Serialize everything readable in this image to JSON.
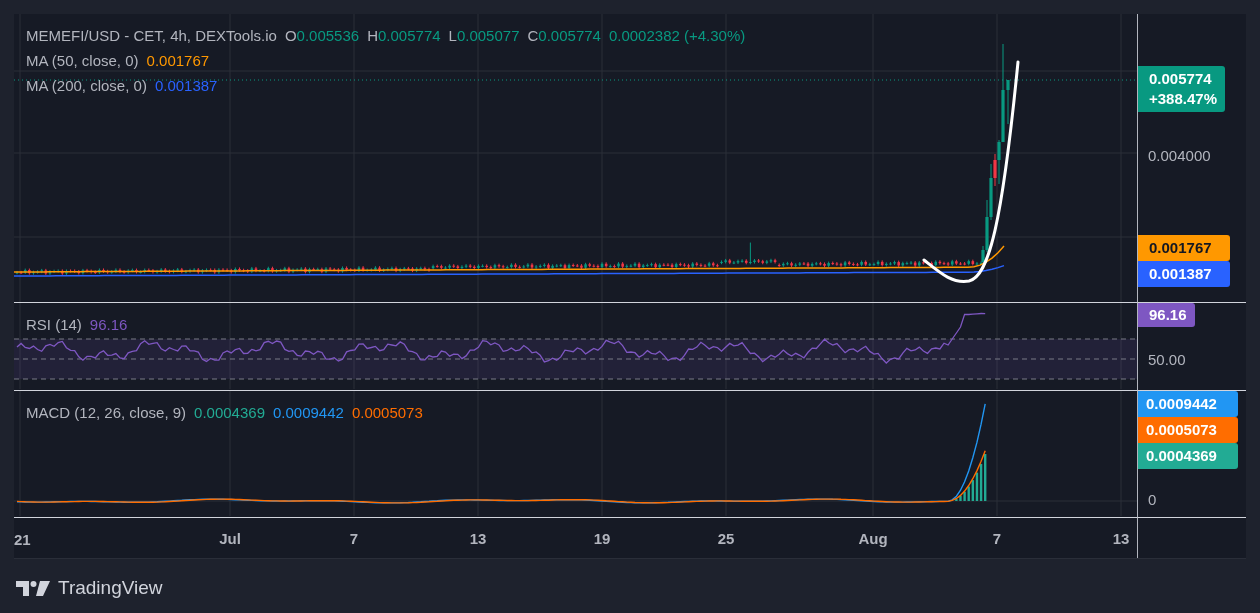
{
  "legend": {
    "symbol": "MEMEFI/USD - CET, 4h, DEXTools.io",
    "ohlc": [
      {
        "key": "O",
        "value": "0.005536"
      },
      {
        "key": "H",
        "value": "0.005774"
      },
      {
        "key": "L",
        "value": "0.005077"
      },
      {
        "key": "C",
        "value": "0.005774"
      }
    ],
    "change": "0.0002382 (+4.30%)",
    "color": "#089981"
  },
  "indicators": [
    {
      "label": "MA (50, close, 0)",
      "value": "0.001767",
      "color": "#ff9800"
    },
    {
      "label": "MA (200, close, 0)",
      "value": "0.001387",
      "color": "#2962ff"
    }
  ],
  "price_axis": {
    "ticks": [
      "0.004000"
    ],
    "badges": [
      {
        "value": "0.005774",
        "change": "+388.47%",
        "color": "#089981"
      },
      {
        "value": "0.001767",
        "color": "#ff9800"
      },
      {
        "value": "0.001387",
        "color": "#2962ff"
      }
    ]
  },
  "rsi": {
    "label": "RSI (14)",
    "value": "96.16",
    "color": "#7e57c2",
    "ticks": [
      "50.00"
    ],
    "badge": {
      "value": "96.16",
      "color": "#7e57c2"
    }
  },
  "macd": {
    "label": "MACD (12, 26, close, 9)",
    "values": [
      {
        "value": "0.0004369",
        "color": "#22ab94"
      },
      {
        "value": "0.0009442",
        "color": "#2196f3"
      },
      {
        "value": "0.0005073",
        "color": "#ff6d00"
      }
    ],
    "badges": [
      {
        "value": "0.0009442",
        "color": "#2196f3"
      },
      {
        "value": "0.0005073",
        "color": "#ff6d00"
      },
      {
        "value": "0.0004369",
        "color": "#22ab94"
      }
    ],
    "ticks": [
      "0"
    ]
  },
  "time_axis": [
    "21",
    "Jul",
    "7",
    "13",
    "19",
    "25",
    "Aug",
    "7",
    "13"
  ],
  "footer": {
    "brand": "TradingView"
  }
}
